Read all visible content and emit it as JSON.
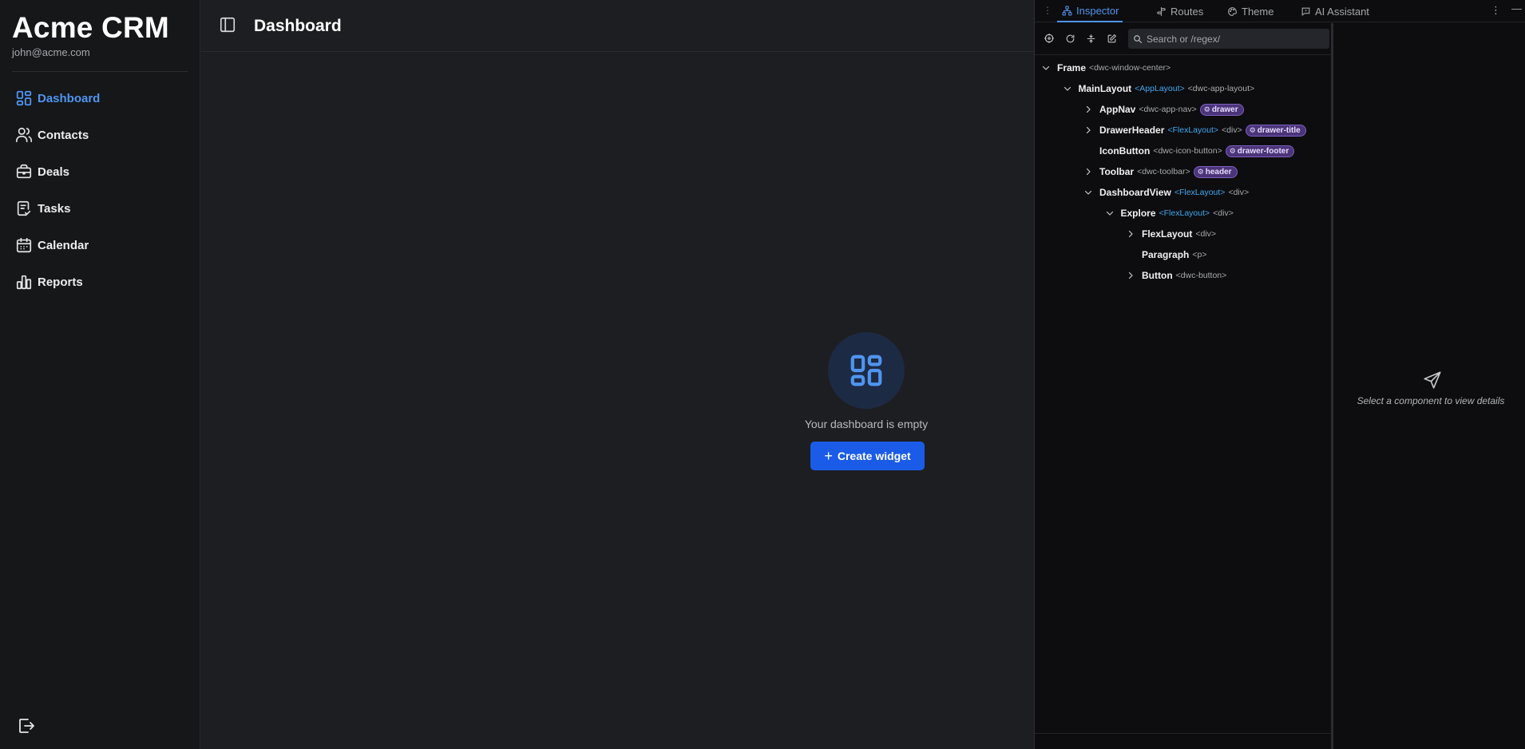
{
  "app": {
    "title": "Acme CRM",
    "user_email": "john@acme.com"
  },
  "sidebar": {
    "items": [
      {
        "label": "Dashboard",
        "icon": "dashboard-icon",
        "active": true
      },
      {
        "label": "Contacts",
        "icon": "users-icon",
        "active": false
      },
      {
        "label": "Deals",
        "icon": "briefcase-icon",
        "active": false
      },
      {
        "label": "Tasks",
        "icon": "clipboard-check-icon",
        "active": false
      },
      {
        "label": "Calendar",
        "icon": "calendar-icon",
        "active": false
      },
      {
        "label": "Reports",
        "icon": "bar-chart-icon",
        "active": false
      }
    ],
    "logout_icon": "logout-icon"
  },
  "header": {
    "title": "Dashboard",
    "toggle_icon": "sidebar-toggle-icon"
  },
  "empty_state": {
    "message": "Your dashboard is empty",
    "button_label": "Create widget",
    "icon": "dashboard-icon"
  },
  "devtools": {
    "tabs": [
      {
        "label": "Inspector",
        "icon": "hierarchy-icon",
        "active": true
      },
      {
        "label": "Routes",
        "icon": "signpost-icon",
        "active": false
      },
      {
        "label": "Theme",
        "icon": "palette-icon",
        "active": false
      },
      {
        "label": "AI Assistant",
        "icon": "chat-icon",
        "active": false
      }
    ],
    "search_placeholder": "Search or /regex/",
    "tree": [
      {
        "name": "Frame",
        "type": "",
        "tag": "<dwc-window-center>",
        "slot": "",
        "depth": 0,
        "chevron": "down"
      },
      {
        "name": "MainLayout",
        "type": "<AppLayout>",
        "tag": "<dwc-app-layout>",
        "slot": "",
        "depth": 1,
        "chevron": "down"
      },
      {
        "name": "AppNav",
        "type": "",
        "tag": "<dwc-app-nav>",
        "slot": "drawer",
        "depth": 2,
        "chevron": "right"
      },
      {
        "name": "DrawerHeader",
        "type": "<FlexLayout>",
        "tag": "<div>",
        "slot": "drawer-title",
        "depth": 2,
        "chevron": "right"
      },
      {
        "name": "IconButton",
        "type": "",
        "tag": "<dwc-icon-button>",
        "slot": "drawer-footer",
        "depth": 2,
        "chevron": "none"
      },
      {
        "name": "Toolbar",
        "type": "",
        "tag": "<dwc-toolbar>",
        "slot": "header",
        "depth": 2,
        "chevron": "right"
      },
      {
        "name": "DashboardView",
        "type": "<FlexLayout>",
        "tag": "<div>",
        "slot": "",
        "depth": 2,
        "chevron": "down"
      },
      {
        "name": "Explore",
        "type": "<FlexLayout>",
        "tag": "<div>",
        "slot": "",
        "depth": 3,
        "chevron": "down"
      },
      {
        "name": "FlexLayout",
        "type": "",
        "tag": "<div>",
        "slot": "",
        "depth": 4,
        "chevron": "right"
      },
      {
        "name": "Paragraph",
        "type": "",
        "tag": "<p>",
        "slot": "",
        "depth": 4,
        "chevron": "none"
      },
      {
        "name": "Button",
        "type": "",
        "tag": "<dwc-button>",
        "slot": "",
        "depth": 4,
        "chevron": "right"
      }
    ],
    "detail_placeholder": "Select a component to view details"
  },
  "colors": {
    "accent": "#4f95f0",
    "primary_button": "#1a5be8",
    "slot_badge": "#4b3478"
  }
}
